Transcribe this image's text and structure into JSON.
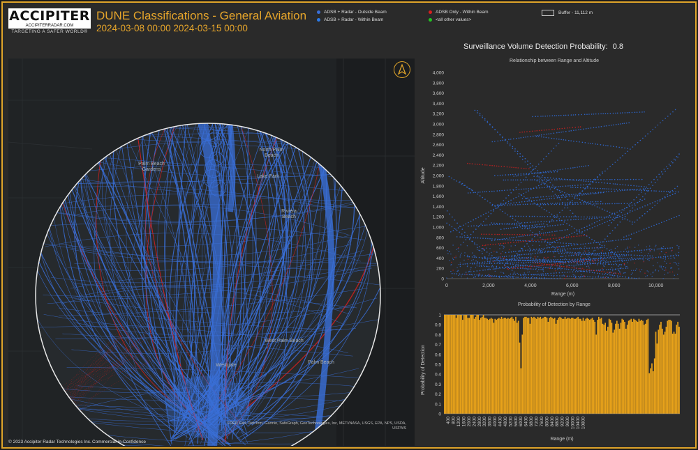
{
  "header": {
    "logo_text": "ACCIPITER",
    "logo_url": "ACCIPITERRADAR.COM",
    "logo_tagline": "TARGETING A SAFER WORLD®",
    "title": "DUNE Classifications - General Aviation",
    "date_range": "2024-03-08 00:00 2024-03-15 00:00"
  },
  "legend": {
    "items": [
      {
        "label": "ADSB + Radar - Outside Beam",
        "color": "#3a6fd8"
      },
      {
        "label": "ADSB + Radar - Within Beam",
        "color": "#2a7ae8"
      },
      {
        "label": "ADSB Only - Within Beam",
        "color": "#d62020"
      },
      {
        "label": "<all other values>",
        "color": "#22c322"
      }
    ],
    "buffer_label": "Buffer - 11,112 m"
  },
  "map": {
    "places": {
      "palm_beach_gardens": "Palm Beach Gardens",
      "north_palm_beach": "North Palm Beach",
      "lake_park": "Lake Park",
      "riviera_beach": "Riviera Beach",
      "west_palm_beach": "West Palm Beach",
      "palm_beach": "Palm Beach",
      "westgate": "Westgate"
    },
    "attribution": "FDEP, Esri, TomTom, Garmin, SafeGraph, GeoTechnologies, Inc, METI/NASA, USGS, EPA, NPS, USDA, USFWS"
  },
  "footer": {
    "copyright": "© 2023 Accipiter Radar Technologies Inc.",
    "confidentiality": "Commercial-in-Confidence"
  },
  "surveillance": {
    "label": "Surveillance Volume Detection Probability:",
    "value": "0.8"
  },
  "chart_data": [
    {
      "type": "scatter",
      "title": "Relationship between Range and Altitude",
      "xlabel": "Range (m)",
      "ylabel": "Altitude",
      "xlim": [
        0,
        11112
      ],
      "ylim": [
        0,
        4000
      ],
      "x_ticks": [
        "0",
        "2,000",
        "4,000",
        "6,000",
        "8,000",
        "10,000"
      ],
      "y_ticks": [
        "0",
        "200",
        "400",
        "600",
        "800",
        "1,000",
        "1,200",
        "1,400",
        "1,600",
        "1,800",
        "2,000",
        "2,200",
        "2,400",
        "2,600",
        "2,800",
        "3,000",
        "3,200",
        "3,400",
        "3,600",
        "3,800",
        "4,000"
      ],
      "series": [
        {
          "name": "ADSB + Radar - Within Beam",
          "color": "#2f6fe0"
        },
        {
          "name": "ADSB Only - Within Beam",
          "color": "#d62020"
        }
      ]
    },
    {
      "type": "bar",
      "title": "Probability of Detection by Range",
      "xlabel": "Range (m)",
      "ylabel": "Probability of Detection",
      "ylim": [
        0,
        1
      ],
      "y_ticks": [
        "0",
        "0.1",
        "0.2",
        "0.3",
        "0.4",
        "0.5",
        "0.6",
        "0.7",
        "0.8",
        "0.9",
        "1"
      ],
      "x_tick_labels": [
        "400",
        "800",
        "1200",
        "1600",
        "2000",
        "2400",
        "2800",
        "3200",
        "3600",
        "4000",
        "4400",
        "4800",
        "5200",
        "5600",
        "6000",
        "6400",
        "6800",
        "7200",
        "7600",
        "8000",
        "8400",
        "8800",
        "9200",
        "9600",
        "10000",
        "10400",
        "10800"
      ],
      "bin_width_m": 100,
      "color": "#e8a21a",
      "values": [
        1,
        1,
        1,
        1,
        1,
        1,
        1,
        1,
        1,
        0.97,
        1,
        1,
        1,
        1,
        0.95,
        1,
        1,
        1,
        0.97,
        0.97,
        1,
        1,
        1,
        0.96,
        0.98,
        1,
        1,
        0.95,
        0.97,
        0.98,
        1,
        0.97,
        0.97,
        0.96,
        0.95,
        0.96,
        0.97,
        0.96,
        0.92,
        0.96,
        0.95,
        0.96,
        0.97,
        0.96,
        0.98,
        0.96,
        0.97,
        0.97,
        0.96,
        0.97,
        0.96,
        0.97,
        0.98,
        0.96,
        0.94,
        0.98,
        0.92,
        0.94,
        0.72,
        0.46,
        0.8,
        0.97,
        0.98,
        0.98,
        0.97,
        0.97,
        0.91,
        0.98,
        0.97,
        0.98,
        0.97,
        0.96,
        0.98,
        0.97,
        0.98,
        0.96,
        0.97,
        0.98,
        0.98,
        0.97,
        0.93,
        0.97,
        0.98,
        0.97,
        0.96,
        0.97,
        0.91,
        0.95,
        0.97,
        0.98,
        0.97,
        0.96,
        0.96,
        0.98,
        0.96,
        0.97,
        0.97,
        0.96,
        0.97,
        0.97,
        0.96,
        0.96,
        0.97,
        0.98,
        0.96,
        0.96,
        0.94,
        0.97,
        0.94,
        0.96,
        0.97,
        0.96,
        0.95,
        0.96,
        0.97,
        0.95,
        0.93,
        0.8,
        0.95,
        0.98,
        0.96,
        0.97,
        0.91,
        0.9,
        0.92,
        0.84,
        0.88,
        0.96,
        0.95,
        0.92,
        0.82,
        0.85,
        0.91,
        0.94,
        0.91,
        0.86,
        0.92,
        0.96,
        0.95,
        0.93,
        0.86,
        0.9,
        0.94,
        0.95,
        0.96,
        0.93,
        0.96,
        0.95,
        0.94,
        0.93,
        0.96,
        0.94,
        0.95,
        0.94,
        0.9,
        0.91,
        0.95,
        0.96,
        0.41,
        0.46,
        0.51,
        0.43,
        0.56,
        0.83,
        0.71,
        0.85,
        0.9,
        0.93,
        0.86,
        0.8,
        0.83,
        0.88,
        0.94,
        0.95,
        0.95,
        0.94,
        0.81,
        0.83,
        0.81,
        0.9,
        0.93,
        0.88
      ]
    }
  ]
}
